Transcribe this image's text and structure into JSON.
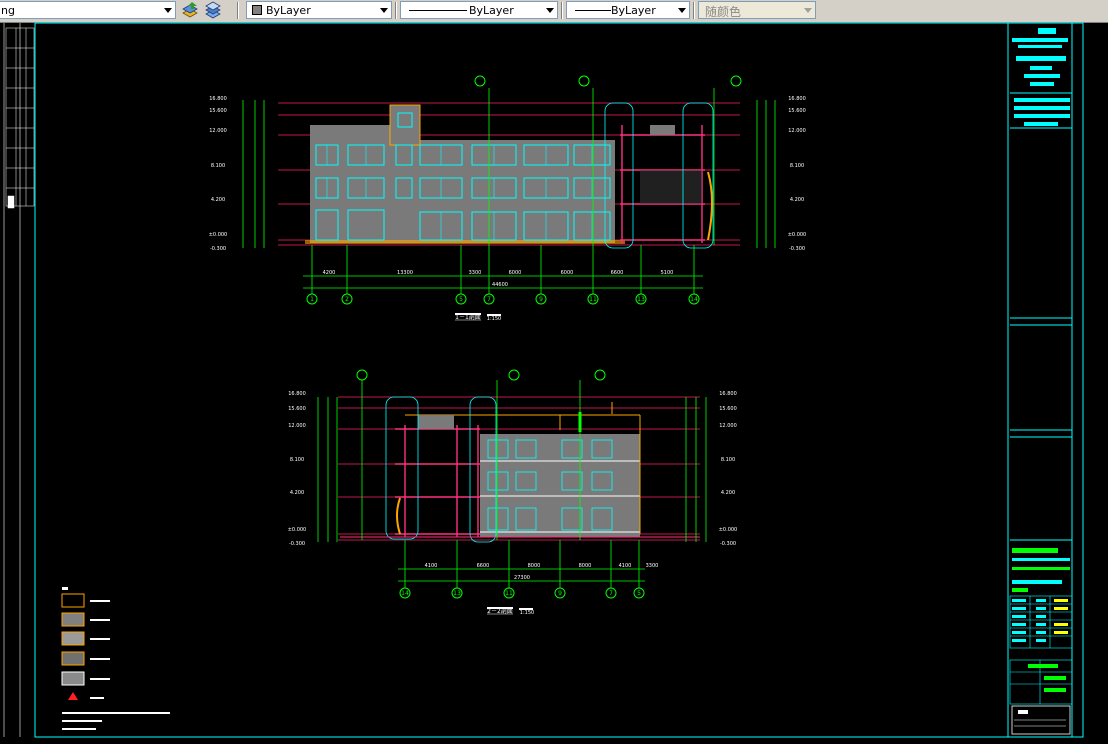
{
  "toolbar": {
    "layer_combo_value": "ng",
    "color_control_value": "ByLayer",
    "linetype_control_value": "ByLayer",
    "lineweight_control_value": "ByLayer",
    "plotstyle_control_value": "随颜色"
  },
  "drawing": {
    "section1": {
      "title": "1－1剖面",
      "scale": "1:150",
      "total_dimension": "44600",
      "dimensions": [
        "4200",
        "13300",
        "3300",
        "6000",
        "6000",
        "6600",
        "5100"
      ],
      "grid_axes": [
        "1",
        "2",
        "5",
        "7",
        "9",
        "11",
        "13",
        "14"
      ],
      "elevations_left": [
        "16.800",
        "15.600",
        "12.000",
        "8.100",
        "4.200",
        "±0.000",
        "-0.300"
      ],
      "elevations_right": [
        "16.800",
        "15.600",
        "12.000",
        "8.100",
        "4.200",
        "±0.000",
        "-0.300"
      ]
    },
    "section2": {
      "title": "2－2剖面",
      "scale": "1:150",
      "total_dimension": "27300",
      "dimensions": [
        "4100",
        "6600",
        "8000",
        "8000",
        "4100",
        "3300"
      ],
      "grid_axes": [
        "14",
        "13",
        "11",
        "9",
        "7",
        "5"
      ],
      "elevations_left": [
        "16.800",
        "15.600",
        "12.000",
        "8.100",
        "4.200",
        "±0.000",
        "-0.300"
      ],
      "elevations_right": [
        "16.800",
        "15.600",
        "12.000",
        "8.100",
        "4.200",
        "±0.000",
        "-0.300"
      ]
    }
  }
}
